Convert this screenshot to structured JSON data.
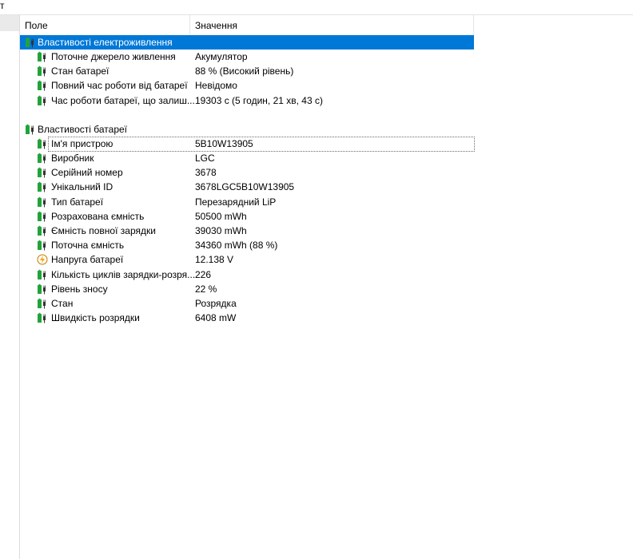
{
  "header": {
    "field": "Поле",
    "value": "Значення"
  },
  "topstrip_text": "т",
  "groups": [
    {
      "title": "Властивості електроживлення",
      "items": [
        {
          "field": "Поточне джерело живлення",
          "value": "Акумулятор",
          "icon": "battery-plug-icon"
        },
        {
          "field": "Стан батареї",
          "value": "88 % (Високий рівень)",
          "icon": "battery-plug-icon"
        },
        {
          "field": "Повний час роботи від батареї",
          "value": "Невідомо",
          "icon": "battery-plug-icon"
        },
        {
          "field": "Час роботи батареї, що залиш...",
          "value": "19303 с (5 годин, 21 хв, 43 с)",
          "icon": "battery-plug-icon"
        }
      ]
    },
    {
      "title": "Властивості батареї",
      "items": [
        {
          "field": "Ім'я пристрою",
          "value": "5B10W13905",
          "icon": "battery-plug-icon"
        },
        {
          "field": "Виробник",
          "value": "LGC",
          "icon": "battery-plug-icon"
        },
        {
          "field": "Серійний номер",
          "value": "3678",
          "icon": "battery-plug-icon"
        },
        {
          "field": "Унікальний ID",
          "value": "3678LGC5B10W13905",
          "icon": "battery-plug-icon"
        },
        {
          "field": "Тип батареї",
          "value": "Перезарядний LiP",
          "icon": "battery-plug-icon"
        },
        {
          "field": "Розрахована ємність",
          "value": "50500 mWh",
          "icon": "battery-plug-icon"
        },
        {
          "field": "Ємність повної зарядки",
          "value": "39030 mWh",
          "icon": "battery-plug-icon"
        },
        {
          "field": "Поточна ємність",
          "value": "34360 mWh  (88 %)",
          "icon": "battery-plug-icon"
        },
        {
          "field": "Напруга батареї",
          "value": "12.138 V",
          "icon": "lightning-icon"
        },
        {
          "field": "Кількість циклів зарядки-розря...",
          "value": "226",
          "icon": "battery-plug-icon"
        },
        {
          "field": "Рівень зносу",
          "value": "22 %",
          "icon": "battery-plug-icon"
        },
        {
          "field": "Стан",
          "value": "Розрядка",
          "icon": "battery-plug-icon"
        },
        {
          "field": "Швидкість розрядки",
          "value": "6408 mW",
          "icon": "battery-plug-icon"
        }
      ]
    }
  ],
  "colors": {
    "selection": "#0078d7",
    "battery": "#22a33a",
    "lightning": "#f2a600"
  }
}
